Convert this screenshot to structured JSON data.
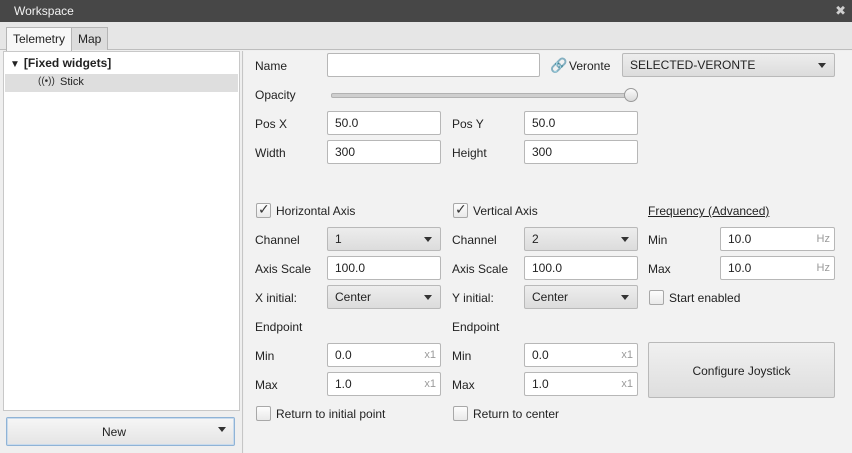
{
  "window": {
    "title": "Workspace",
    "close": "✖"
  },
  "tabs": [
    {
      "label": "Telemetry"
    },
    {
      "label": "Map"
    }
  ],
  "tree": {
    "group": "[Fixed widgets]",
    "item": "Stick",
    "item_icon": "radio-waves-icon"
  },
  "new_button": {
    "label": "New"
  },
  "form": {
    "name_label": "Name",
    "name_value": "",
    "veronte_label": "Veronte",
    "veronte_value": "SELECTED-VERONTE",
    "opacity_label": "Opacity",
    "opacity_value": 1.0,
    "posx_label": "Pos X",
    "posx_value": "50.0",
    "posy_label": "Pos Y",
    "posy_value": "50.0",
    "width_label": "Width",
    "width_value": "300",
    "height_label": "Height",
    "height_value": "300"
  },
  "horizontal": {
    "checkbox_label": "Horizontal Axis",
    "checked": true,
    "channel_label": "Channel",
    "channel_value": "1",
    "scale_label": "Axis Scale",
    "scale_value": "100.0",
    "initial_label": "X initial:",
    "initial_value": "Center",
    "endpoint_label": "Endpoint",
    "min_label": "Min",
    "min_value": "0.0",
    "min_unit": "x1",
    "max_label": "Max",
    "max_value": "1.0",
    "max_unit": "x1",
    "return_label": "Return to initial point",
    "return_checked": false
  },
  "vertical": {
    "checkbox_label": "Vertical Axis",
    "checked": true,
    "channel_label": "Channel",
    "channel_value": "2",
    "scale_label": "Axis Scale",
    "scale_value": "100.0",
    "initial_label": "Y initial:",
    "initial_value": "Center",
    "endpoint_label": "Endpoint",
    "min_label": "Min",
    "min_value": "0.0",
    "min_unit": "x1",
    "max_label": "Max",
    "max_value": "1.0",
    "max_unit": "x1",
    "return_label": "Return to center",
    "return_checked": false
  },
  "frequency": {
    "title": "Frequency (Advanced)",
    "min_label": "Min",
    "min_value": "10.0",
    "min_unit": "Hz",
    "max_label": "Max",
    "max_value": "10.0",
    "max_unit": "Hz",
    "start_label": "Start enabled",
    "start_checked": false
  },
  "configure_button": {
    "label": "Configure Joystick"
  },
  "colors": {
    "titlebar": "#474747",
    "selection": "#dedede",
    "accent_border": "#8fb3d6"
  }
}
